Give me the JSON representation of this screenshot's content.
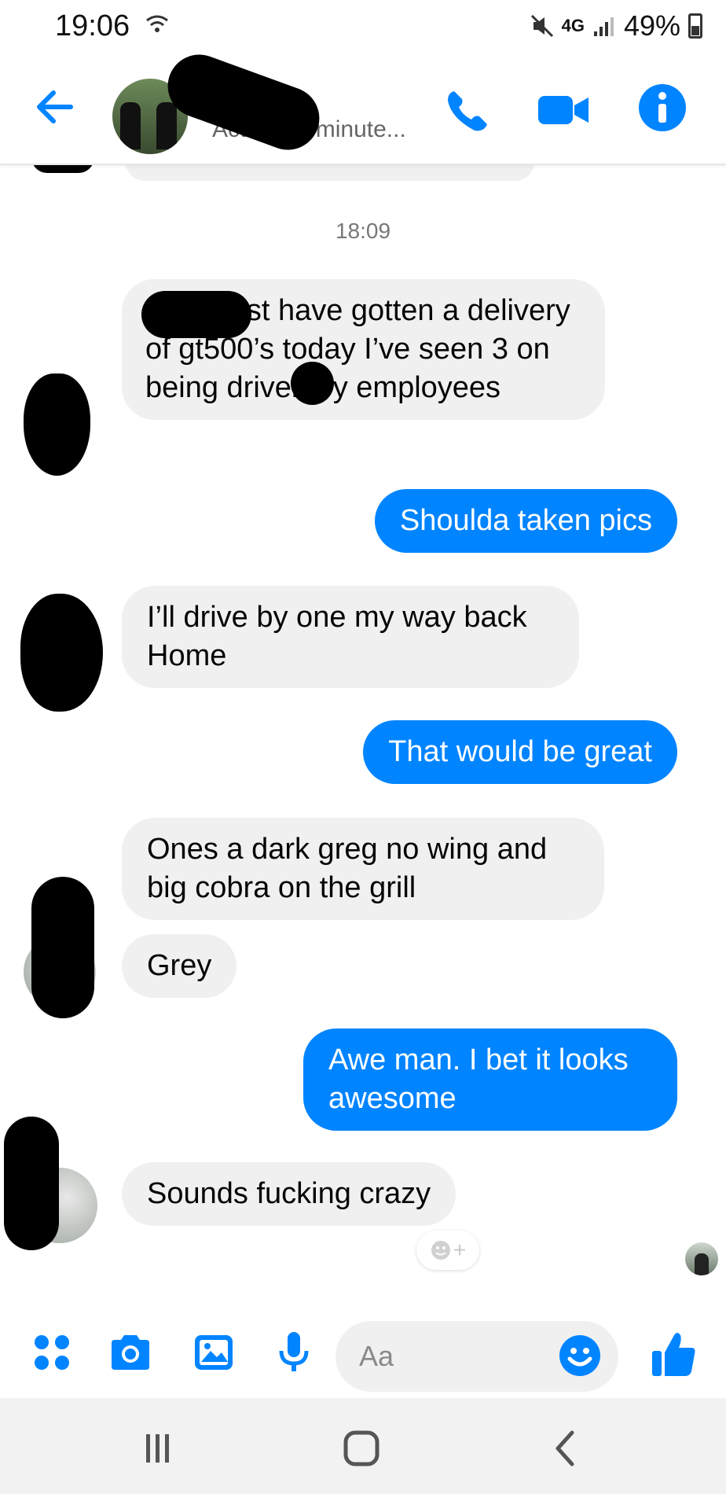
{
  "status_bar": {
    "time": "19:06",
    "network": "4G",
    "battery": "49%"
  },
  "header": {
    "active_status": "Active 42 minute..."
  },
  "chat": {
    "timestamp": "18:09",
    "messages": [
      {
        "direction": "in",
        "text": "ford must have gotten a delivery of gt500’s today I’ve seen 3 on being driven by employees"
      },
      {
        "direction": "out",
        "text": "Shoulda taken pics"
      },
      {
        "direction": "in",
        "text": "I’ll drive by one my way back Home"
      },
      {
        "direction": "out",
        "text": "That would be great"
      },
      {
        "direction": "in",
        "text": "Ones a dark greg no wing and big cobra on the grill"
      },
      {
        "direction": "in",
        "text": "Grey"
      },
      {
        "direction": "out",
        "text": "Awe man. I bet it looks awesome"
      },
      {
        "direction": "in",
        "text": "Sounds fucking crazy"
      }
    ]
  },
  "composer": {
    "placeholder": "Aa"
  },
  "colors": {
    "accent": "#0084ff",
    "incoming_bubble": "#f0f0f0",
    "navbar": "#f2f2f2"
  },
  "icons": {
    "header": [
      "back-arrow-icon",
      "phone-icon",
      "video-camera-icon",
      "info-icon"
    ],
    "composer": [
      "apps-grid-icon",
      "camera-icon",
      "gallery-icon",
      "microphone-icon",
      "emoji-icon",
      "thumbs-up-icon"
    ],
    "navbar": [
      "recent-apps-icon",
      "home-icon",
      "back-icon"
    ]
  }
}
